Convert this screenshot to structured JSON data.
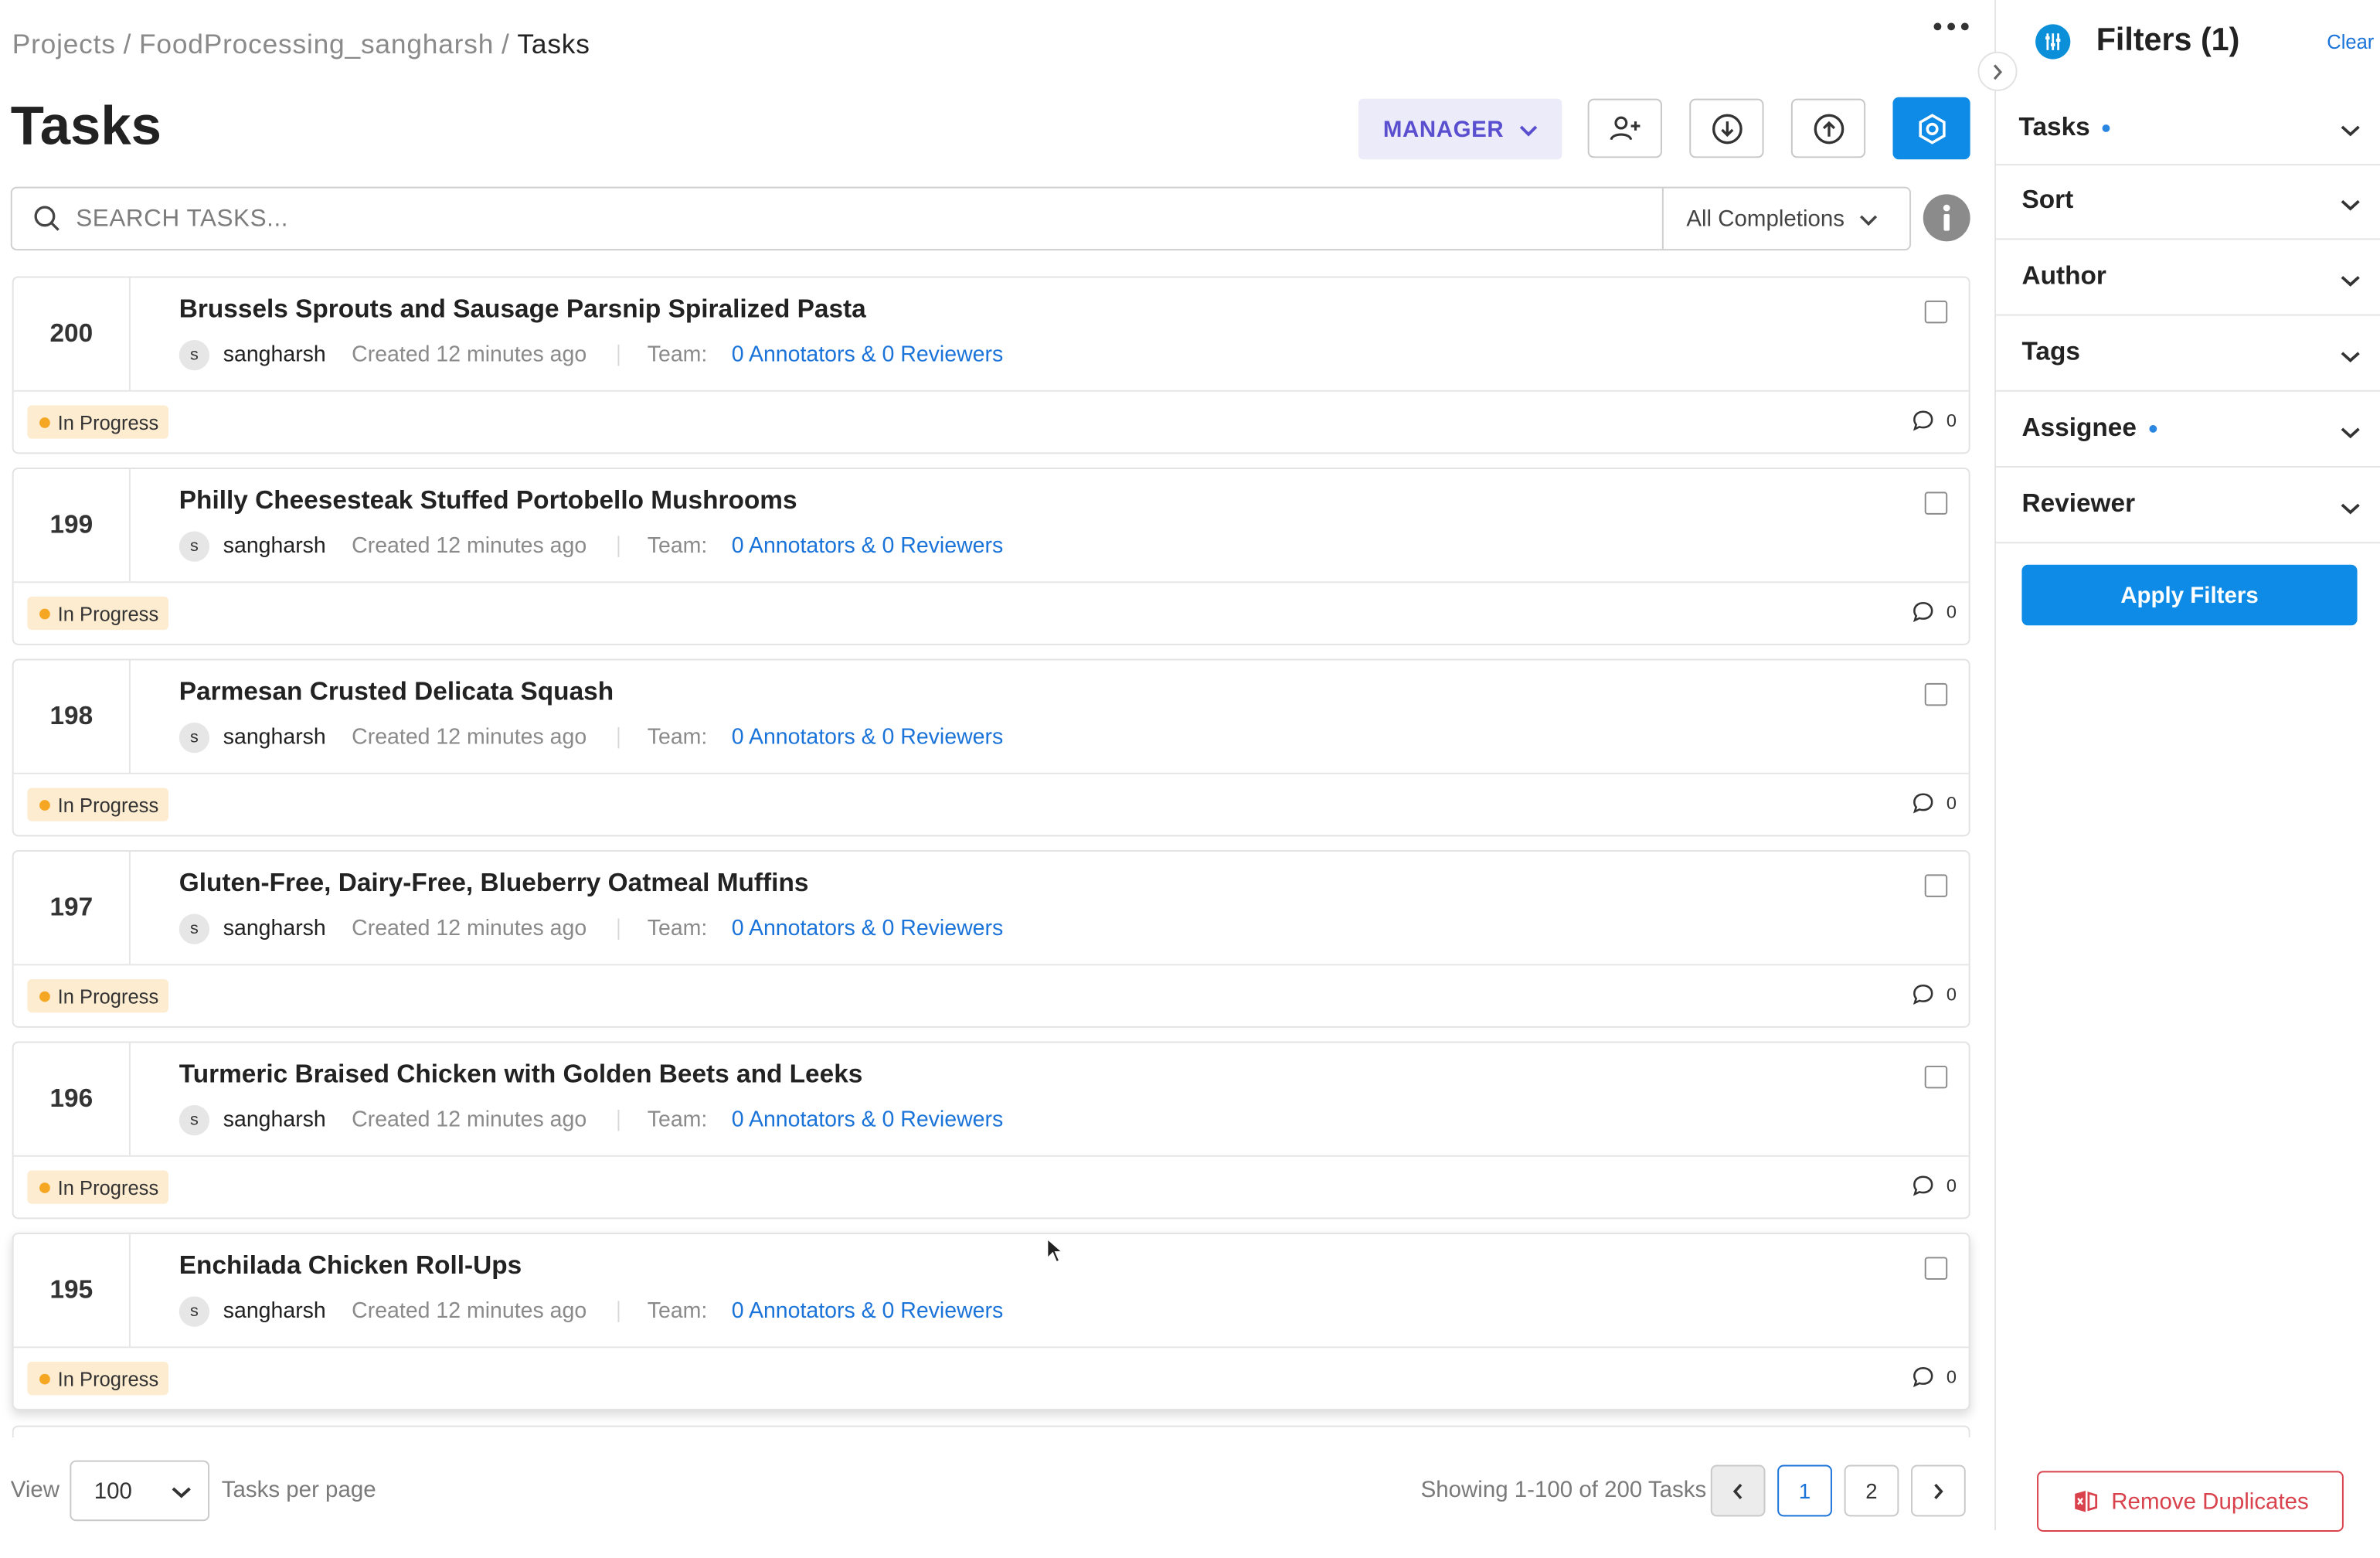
{
  "breadcrumb": {
    "root": "Projects",
    "project": "FoodProcessing_sangharsh",
    "current": "Tasks",
    "separator": "/"
  },
  "header": {
    "title": "Tasks",
    "role_label": "MANAGER",
    "icons": [
      "more-horizontal-icon",
      "add-user-icon",
      "download-icon",
      "upload-icon",
      "settings-icon"
    ]
  },
  "search": {
    "placeholder": "SEARCH TASKS...",
    "value": "",
    "completion_filter": "All Completions"
  },
  "tasks": [
    {
      "id": "200",
      "title": "Brussels Sprouts and Sausage Parsnip Spiralized Pasta",
      "avatar": "s",
      "author": "sangharsh",
      "created": "Created 12 minutes ago",
      "team_label": "Team:",
      "team": "0 Annotators & 0 Reviewers",
      "status": "In Progress",
      "comments": "0"
    },
    {
      "id": "199",
      "title": "Philly Cheesesteak Stuffed Portobello Mushrooms",
      "avatar": "s",
      "author": "sangharsh",
      "created": "Created 12 minutes ago",
      "team_label": "Team:",
      "team": "0 Annotators & 0 Reviewers",
      "status": "In Progress",
      "comments": "0"
    },
    {
      "id": "198",
      "title": "Parmesan Crusted Delicata Squash",
      "avatar": "s",
      "author": "sangharsh",
      "created": "Created 12 minutes ago",
      "team_label": "Team:",
      "team": "0 Annotators & 0 Reviewers",
      "status": "In Progress",
      "comments": "0"
    },
    {
      "id": "197",
      "title": "Gluten-Free, Dairy-Free, Blueberry Oatmeal Muffins",
      "avatar": "s",
      "author": "sangharsh",
      "created": "Created 12 minutes ago",
      "team_label": "Team:",
      "team": "0 Annotators & 0 Reviewers",
      "status": "In Progress",
      "comments": "0"
    },
    {
      "id": "196",
      "title": "Turmeric Braised Chicken with Golden Beets and Leeks",
      "avatar": "s",
      "author": "sangharsh",
      "created": "Created 12 minutes ago",
      "team_label": "Team:",
      "team": "0 Annotators & 0 Reviewers",
      "status": "In Progress",
      "comments": "0"
    },
    {
      "id": "195",
      "title": "Enchilada Chicken Roll-Ups",
      "avatar": "s",
      "author": "sangharsh",
      "created": "Created 12 minutes ago",
      "team_label": "Team:",
      "team": "0 Annotators & 0 Reviewers",
      "status": "In Progress",
      "comments": "0"
    }
  ],
  "pagination": {
    "view_label": "View",
    "per_page": "100",
    "per_page_label": "Tasks per page",
    "showing": "Showing 1-100 of 200 Tasks",
    "pages": [
      "1",
      "2"
    ],
    "current_page": "1"
  },
  "filters_panel": {
    "title": "Filters (1)",
    "clear_label": "Clear",
    "sections": [
      {
        "label": "Tasks",
        "active": true
      },
      {
        "label": "Sort",
        "active": false
      },
      {
        "label": "Author",
        "active": false
      },
      {
        "label": "Tags",
        "active": false
      },
      {
        "label": "Assignee",
        "active": true
      },
      {
        "label": "Reviewer",
        "active": false
      }
    ],
    "apply_label": "Apply Filters",
    "remove_duplicates_label": "Remove Duplicates"
  },
  "colors": {
    "primary": "#0d8be6",
    "link": "#1a73d9",
    "role_bg": "#ecebfa",
    "role_text": "#5a4fcf",
    "status_bg": "#fdecd0",
    "status_dot": "#f5a623",
    "danger": "#d9414c"
  }
}
